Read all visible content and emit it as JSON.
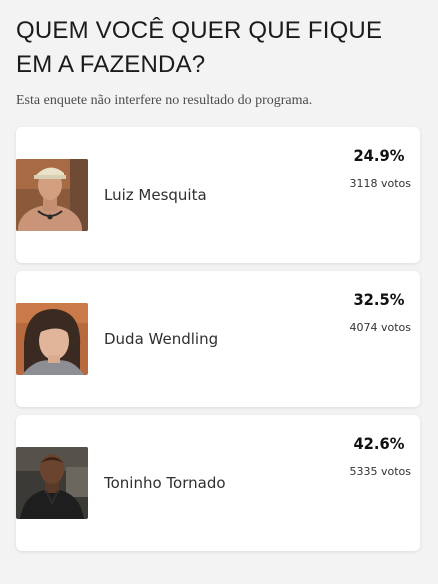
{
  "poll": {
    "title": "QUEM VOCÊ QUER QUE FIQUE EM A FAZENDA?",
    "subtitle": "Esta enquete não interfere no resultado do programa."
  },
  "options": [
    {
      "name": "Luiz Mesquita",
      "percent_label": "24.9%",
      "percent": 24.9,
      "votes_label": "3118 votos",
      "votes": 3118
    },
    {
      "name": "Duda Wendling",
      "percent_label": "32.5%",
      "percent": 32.5,
      "votes_label": "4074 votos",
      "votes": 4074
    },
    {
      "name": "Toninho Tornado",
      "percent_label": "42.6%",
      "percent": 42.6,
      "votes_label": "5335 votos",
      "votes": 5335
    }
  ]
}
